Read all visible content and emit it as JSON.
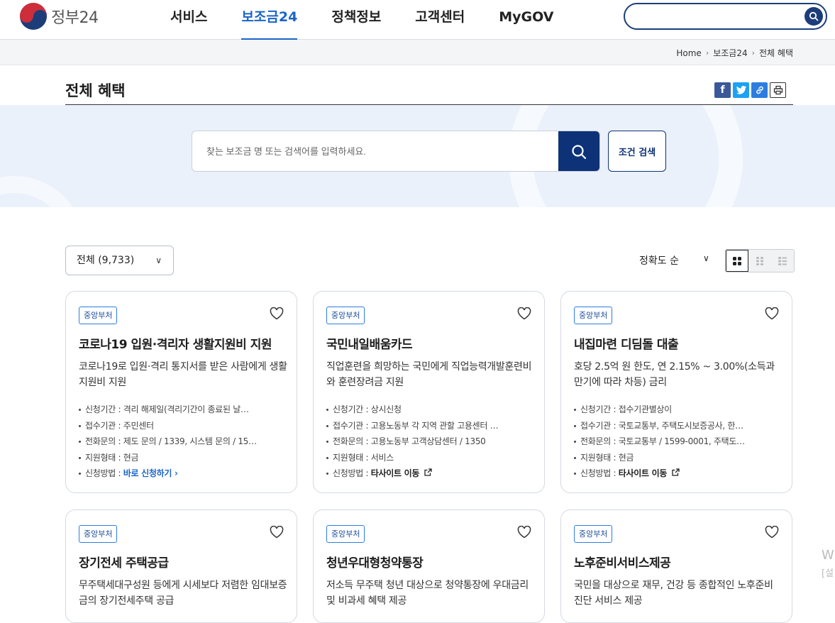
{
  "header": {
    "logo_text": "정부24",
    "nav": [
      "서비스",
      "보조금24",
      "정책정보",
      "고객센터",
      "MyGOV"
    ],
    "active_nav": "보조금24"
  },
  "breadcrumb": [
    "Home",
    "보조금24",
    "전체 혜택"
  ],
  "page": {
    "title": "전체 혜택"
  },
  "share": {
    "facebook": "f",
    "twitter": "t"
  },
  "search": {
    "placeholder": "찾는 보조금 명 또는 검색어를 입력하세요.",
    "condition_button": "조건 검색"
  },
  "filter": {
    "label": "전체 (9,733)",
    "sort": "정확도 순"
  },
  "cards": [
    {
      "badge": "중앙부처",
      "title": "코로나19 입원·격리자 생활지원비 지원",
      "desc": "코로나19로 입원·격리 통지서를 받은 사람에게 생활지원비 지원",
      "period": "신청기간 : 격리 해제일(격리기간이 종료된 날…",
      "agency": "접수기관 : 주민센터",
      "phone": "전화문의 : 제도 문의 / 1339, 시스템 문의 / 15…",
      "type": "지원형태 : 현금",
      "method_label": "신청방법 : ",
      "method_value": "바로 신청하기",
      "method_kind": "direct"
    },
    {
      "badge": "중앙부처",
      "title": "국민내일배움카드",
      "desc": "직업훈련을 희망하는 국민에게 직업능력개발훈련비와 훈련장려금 지원",
      "period": "신청기간 : 상시신청",
      "agency": "접수기관 : 고용노동부 각 지역 관할 고용센터 …",
      "phone": "전화문의 : 고용노동부 고객상담센터 / 1350",
      "type": "지원형태 : 서비스",
      "method_label": "신청방법 : ",
      "method_value": "타사이트 이동",
      "method_kind": "external"
    },
    {
      "badge": "중앙부처",
      "title": "내집마련 디딤돌 대출",
      "desc": "호당 2.5억 원 한도, 연 2.15% ~ 3.00%(소득과 만기에 따라 차등) 금리",
      "period": "신청기간 : 접수기관별상이",
      "agency": "접수기관 : 국토교통부, 주택도시보증공사, 한…",
      "phone": "전화문의 : 국토교통부 / 1599-0001, 주택도…",
      "type": "지원형태 : 현금",
      "method_label": "신청방법 : ",
      "method_value": "타사이트 이동",
      "method_kind": "external"
    },
    {
      "badge": "중앙부처",
      "title": "장기전세 주택공급",
      "desc": "무주택세대구성원 등에게 시세보다 저렴한 임대보증금의 장기전세주택 공급"
    },
    {
      "badge": "중앙부처",
      "title": "청년우대형청약통장",
      "desc": "저소득 무주택 청년 대상으로 청약통장에 우대금리 및 비과세 혜택 제공"
    },
    {
      "badge": "중앙부처",
      "title": "노후준비서비스제공",
      "desc": "국민을 대상으로 재무, 건강 등 종합적인 노후준비 진단 서비스 제공"
    }
  ],
  "watermark": {
    "line1": "W",
    "line2": "[설"
  },
  "colors": {
    "primary": "#0d3278",
    "accent": "#1b64c8",
    "band": "#eaf1fb"
  }
}
